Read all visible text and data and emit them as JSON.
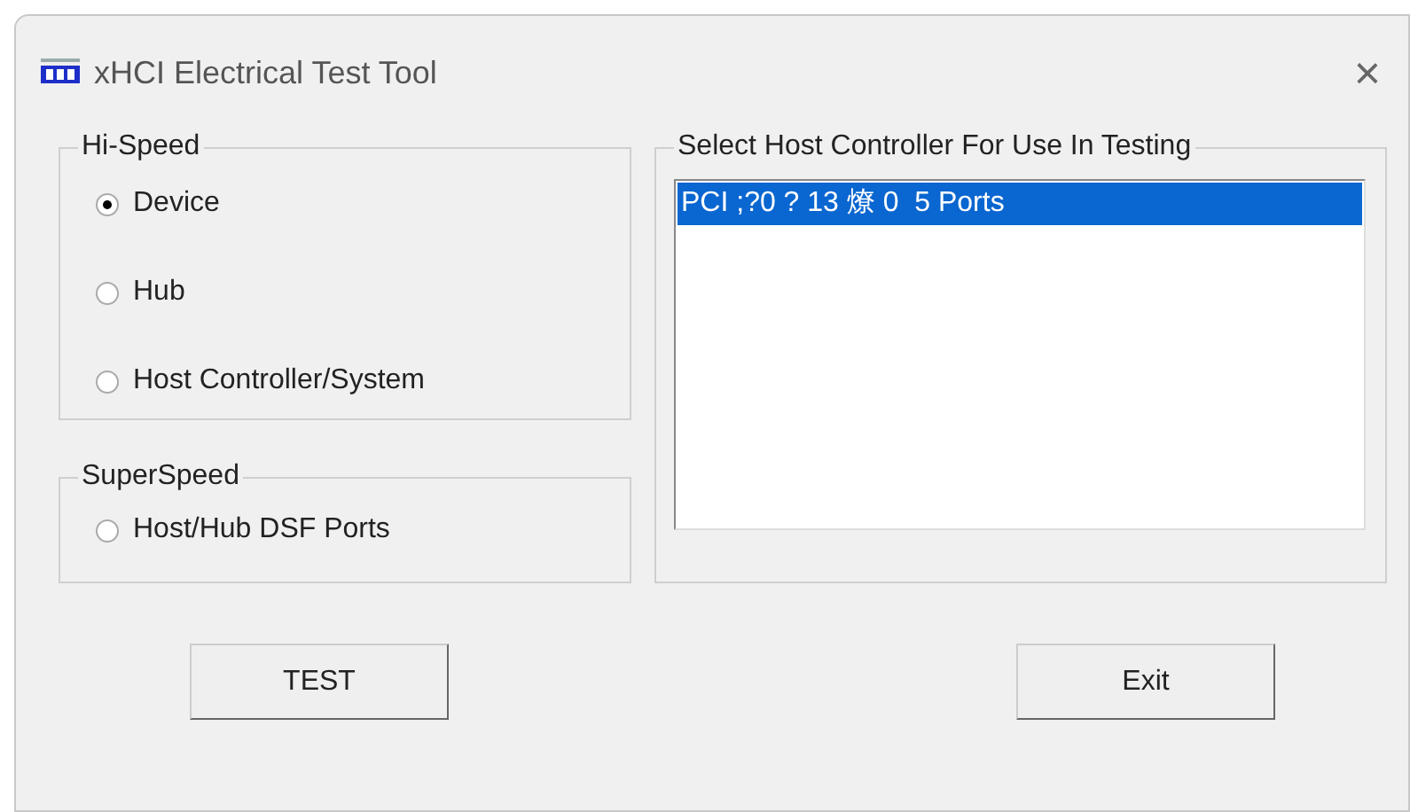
{
  "window": {
    "title": "xHCI Electrical Test Tool",
    "close": "×"
  },
  "groups": [
    {
      "title": "Hi-Speed",
      "options": [
        {
          "label": "Device",
          "selected": true
        },
        {
          "label": "Hub",
          "selected": false
        },
        {
          "label": "Host Controller/System",
          "selected": false
        }
      ]
    },
    {
      "title": "SuperSpeed",
      "options": [
        {
          "label": "Host/Hub DSF Ports",
          "selected": false
        }
      ]
    }
  ],
  "host_controller": {
    "title": "Select Host Controller For Use In Testing",
    "items": [
      {
        "label": "PCI ;?0 ? 13 燎 0  5 Ports",
        "selected": true
      }
    ]
  },
  "buttons": [
    "TEST",
    "Exit"
  ]
}
